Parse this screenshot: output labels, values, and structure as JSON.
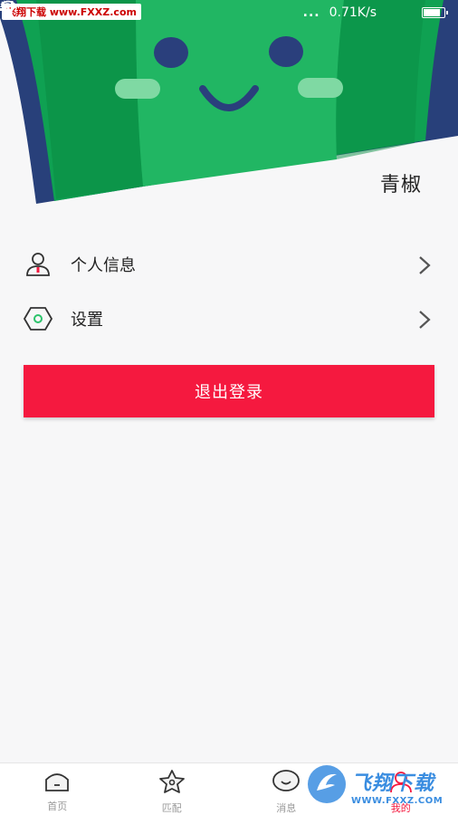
{
  "status_bar": {
    "network_speed": "0.71K/s",
    "dots": "..."
  },
  "watermark_top": "飞翔下载 www.FXXZ.com",
  "profile": {
    "username": "青椒"
  },
  "menu": {
    "items": [
      {
        "label": "个人信息",
        "icon": "person-icon"
      },
      {
        "label": "设置",
        "icon": "settings-hexagon-icon"
      }
    ]
  },
  "logout_label": "退出登录",
  "tabbar": {
    "tabs": [
      {
        "label": "首页",
        "icon": "home-icon"
      },
      {
        "label": "匹配",
        "icon": "match-star-icon"
      },
      {
        "label": "消息",
        "icon": "message-bubble-icon"
      },
      {
        "label": "我的",
        "icon": "me-icon",
        "active": true
      }
    ]
  },
  "watermark_bottom": {
    "big": "飞翔下载",
    "small": "WWW.FXXZ.COM"
  },
  "colors": {
    "accent": "#f5193f",
    "hero_green": "#1faa59",
    "hero_dark_green": "#0c8a3e",
    "hero_border": "#28407a"
  }
}
